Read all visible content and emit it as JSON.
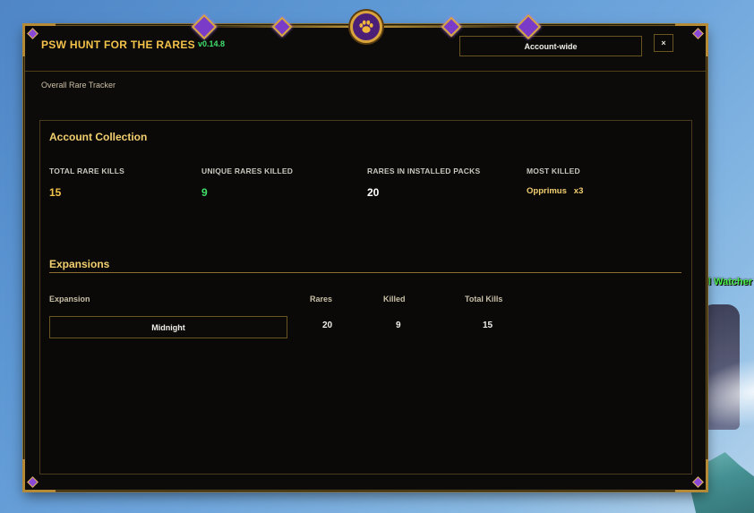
{
  "colors": {
    "accent_gold": "#f3c24a",
    "version_green": "#41e06a",
    "stat_total": "#f3c24a",
    "stat_unique": "#41e06a",
    "stat_installed": "#ffffff",
    "stat_most_killed": "#f2cf6f",
    "window_bg": "#0c0b0a",
    "border_gold": "#8a6b27"
  },
  "window": {
    "title": "PSW HUNT FOR THE RARES",
    "version": "v0.14.8",
    "subtitle": "Overall Rare Tracker",
    "scope_dropdown": {
      "selected": "Account-wide"
    },
    "close_label": "×"
  },
  "account_collection": {
    "heading": "Account Collection",
    "stats": [
      {
        "label": "TOTAL RARE KILLS",
        "value": "15"
      },
      {
        "label": "UNIQUE RARES KILLED",
        "value": "9"
      },
      {
        "label": "RARES IN INSTALLED PACKS",
        "value": "20"
      },
      {
        "label": "MOST KILLED",
        "value": "Opprimus   x3"
      }
    ]
  },
  "expansions": {
    "heading": "Expansions",
    "columns": [
      "Expansion",
      "Rares",
      "Killed",
      "Total Kills"
    ],
    "rows": [
      {
        "expansion": "Midnight",
        "rares": "20",
        "killed": "9",
        "total_kills": "15"
      }
    ]
  },
  "background": {
    "nameplate": "ll Watcher"
  },
  "icons": {
    "medallion": "paw-icon",
    "ornament_gems": "purple-gem-icon"
  }
}
